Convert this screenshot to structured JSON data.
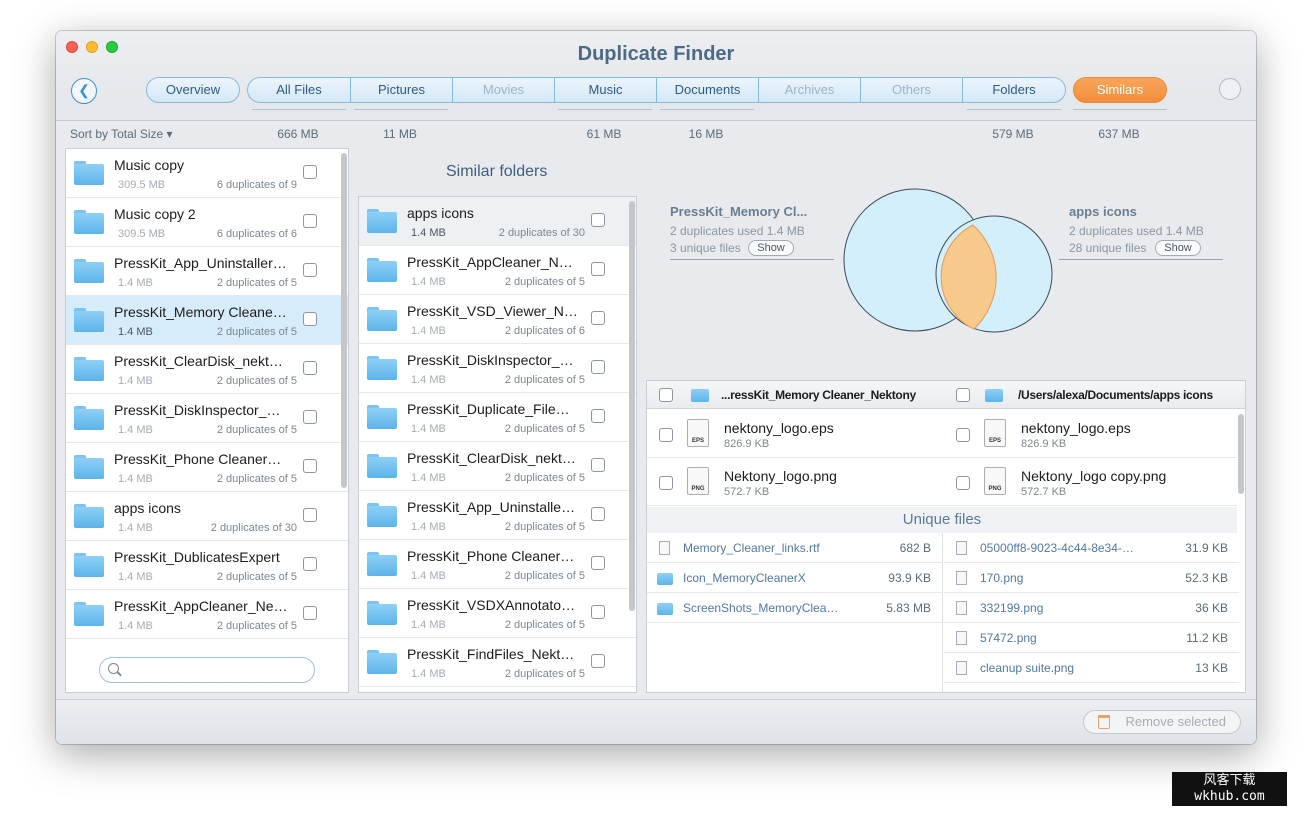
{
  "window": {
    "title": "Duplicate Finder"
  },
  "tabs": [
    {
      "label": "Overview",
      "size": ""
    },
    {
      "label": "All Files",
      "size": "666 MB"
    },
    {
      "label": "Pictures",
      "size": "11 MB"
    },
    {
      "label": "Movies",
      "size": ""
    },
    {
      "label": "Music",
      "size": "61 MB"
    },
    {
      "label": "Documents",
      "size": "16 MB"
    },
    {
      "label": "Archives",
      "size": ""
    },
    {
      "label": "Others",
      "size": ""
    },
    {
      "label": "Folders",
      "size": "579 MB"
    },
    {
      "label": "Similars",
      "size": "637 MB"
    }
  ],
  "sort_label": "Sort by Total Size",
  "left_list": [
    {
      "name": "Music copy",
      "size": "309.5 MB",
      "dups": "6 duplicates of 9"
    },
    {
      "name": "Music copy 2",
      "size": "309.5 MB",
      "dups": "6 duplicates of 6"
    },
    {
      "name": "PressKit_App_Uninstaller…",
      "size": "1.4 MB",
      "dups": "2 duplicates of 5"
    },
    {
      "name": "PressKit_Memory Cleane…",
      "size": "1.4 MB",
      "dups": "2 duplicates of 5"
    },
    {
      "name": "PressKit_ClearDisk_nekt…",
      "size": "1.4 MB",
      "dups": "2 duplicates of 5"
    },
    {
      "name": "PressKit_DiskInspector_…",
      "size": "1.4 MB",
      "dups": "2 duplicates of 5"
    },
    {
      "name": "PressKit_Phone Cleaner…",
      "size": "1.4 MB",
      "dups": "2 duplicates of 5"
    },
    {
      "name": "apps icons",
      "size": "1.4 MB",
      "dups": "2 duplicates of 30"
    },
    {
      "name": "PressKit_DublicatesExpert",
      "size": "1.4 MB",
      "dups": "2 duplicates of 5"
    },
    {
      "name": "PressKit_AppCleaner_Ne…",
      "size": "1.4 MB",
      "dups": "2 duplicates of 5"
    }
  ],
  "search": {
    "placeholder": ""
  },
  "similar": {
    "title": "Similar folders",
    "items": [
      {
        "name": "apps icons",
        "size": "1.4 MB",
        "dups": "2 duplicates of 30"
      },
      {
        "name": "PressKit_AppCleaner_N…",
        "size": "1.4 MB",
        "dups": "2 duplicates of 5"
      },
      {
        "name": "PressKit_VSD_Viewer_N…",
        "size": "1.4 MB",
        "dups": "2 duplicates of 6"
      },
      {
        "name": "PressKit_DiskInspector_…",
        "size": "1.4 MB",
        "dups": "2 duplicates of 5"
      },
      {
        "name": "PressKit_Duplicate_File…",
        "size": "1.4 MB",
        "dups": "2 duplicates of 5"
      },
      {
        "name": "PressKit_ClearDisk_nekt…",
        "size": "1.4 MB",
        "dups": "2 duplicates of 5"
      },
      {
        "name": "PressKit_App_Uninstalle…",
        "size": "1.4 MB",
        "dups": "2 duplicates of 5"
      },
      {
        "name": "PressKit_Phone Cleaner…",
        "size": "1.4 MB",
        "dups": "2 duplicates of 5"
      },
      {
        "name": "PressKit_VSDXAnnotato…",
        "size": "1.4 MB",
        "dups": "2 duplicates of 5"
      },
      {
        "name": "PressKit_FindFiles_Nekt…",
        "size": "1.4 MB",
        "dups": "2 duplicates of 5"
      }
    ]
  },
  "venn": {
    "left": {
      "title": "PressKit_Memory Cl...",
      "dup_line": "2 duplicates used 1.4 MB",
      "unique_line": "3 unique files",
      "show": "Show"
    },
    "right": {
      "title": "apps icons",
      "dup_line": "2 duplicates used 1.4 MB",
      "unique_line": "28 unique files",
      "show": "Show"
    },
    "colors": {
      "left_fill": "#d3effc",
      "right_fill": "#d3effc",
      "overlap": "#f7c98a",
      "stroke": "#3c4a57"
    }
  },
  "compare": {
    "left_path": "...ressKit_Memory Cleaner_Nektony",
    "right_path": "/Users/alexa/Documents/apps icons",
    "pairs": [
      {
        "left_name": "nektony_logo.eps",
        "left_size": "826.9 KB",
        "left_ext": "EPS",
        "right_name": "nektony_logo.eps",
        "right_size": "826.9 KB",
        "right_ext": "EPS"
      },
      {
        "left_name": "Nektony_logo.png",
        "left_size": "572.7 KB",
        "left_ext": "PNG",
        "right_name": "Nektony_logo copy.png",
        "right_size": "572.7 KB",
        "right_ext": "PNG"
      }
    ],
    "unique_title": "Unique files",
    "unique_left": [
      {
        "name": "Memory_Cleaner_links.rtf",
        "size": "682 B",
        "icon": "file-icon"
      },
      {
        "name": "Icon_MemoryCleanerX",
        "size": "93.9 KB",
        "icon": "folder-icon"
      },
      {
        "name": "ScreenShots_MemoryClea…",
        "size": "5.83 MB",
        "icon": "folder-icon"
      }
    ],
    "unique_right": [
      {
        "name": "05000ff8-9023-4c44-8e34-…",
        "size": "31.9 KB",
        "icon": "image-file-icon"
      },
      {
        "name": "170.png",
        "size": "52.3 KB",
        "icon": "image-file-icon"
      },
      {
        "name": "332199.png",
        "size": "36 KB",
        "icon": "image-file-icon"
      },
      {
        "name": "57472.png",
        "size": "11.2 KB",
        "icon": "image-file-icon"
      },
      {
        "name": "cleanup suite.png",
        "size": "13 KB",
        "icon": "image-file-icon"
      }
    ]
  },
  "remove_label": "Remove selected",
  "watermark": {
    "line1": "风客下载",
    "line2": "wkhub.com"
  }
}
